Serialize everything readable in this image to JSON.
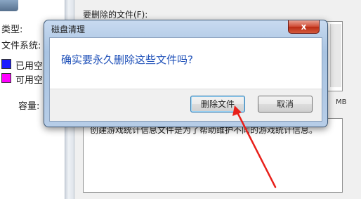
{
  "background": {
    "properties": {
      "type_label": "类型:",
      "filesystem_label": "文件系统:",
      "used_label": "已用空",
      "free_label": "可用空",
      "capacity_label": "容量:",
      "used_color": "#1a1aff",
      "free_color": "#ff00ff"
    },
    "cleanup": {
      "top_text": "要删除的文件(F):",
      "size_unit": "MB",
      "description": "创建游戏统计信息文件是为了帮助维护不同的游戏统计信息。"
    }
  },
  "dialog": {
    "title": "磁盘清理",
    "close_label": "x",
    "message": "确实要永久删除这些文件吗?",
    "delete_label": "删除文件",
    "cancel_label": "取消"
  },
  "annotation": {
    "arrow_color": "#e8201a"
  }
}
